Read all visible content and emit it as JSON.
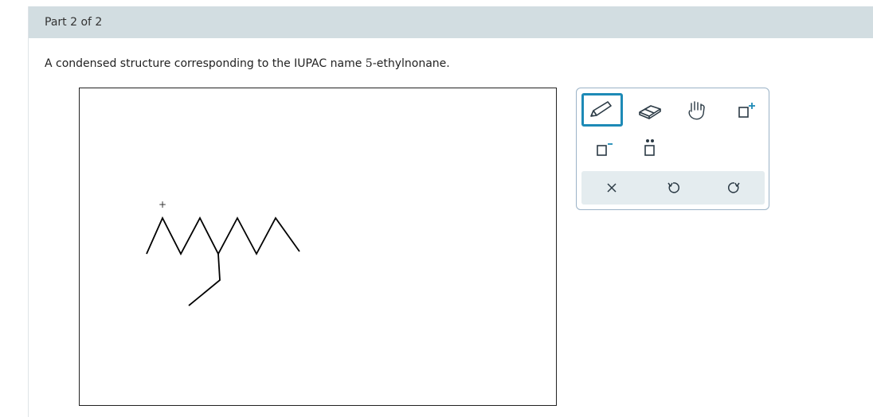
{
  "part_header": {
    "label": "Part 2 of 2"
  },
  "prompt": {
    "text_before": "A condensed structure corresponding to the IUPAC name ",
    "number": "5",
    "text_after": "-ethylnonane."
  },
  "canvas": {
    "cursor_mark": "+"
  },
  "toolbar": {
    "tools": [
      {
        "name": "pencil-icon",
        "selected": true
      },
      {
        "name": "eraser-icon",
        "selected": false
      },
      {
        "name": "hand-icon",
        "selected": false
      },
      {
        "name": "add-positive-charge-icon",
        "selected": false
      },
      {
        "name": "add-negative-charge-icon",
        "selected": false
      },
      {
        "name": "lone-pair-icon",
        "selected": false
      }
    ],
    "actions": [
      {
        "name": "clear-icon"
      },
      {
        "name": "undo-icon"
      },
      {
        "name": "redo-icon"
      }
    ]
  },
  "colors": {
    "header_bg": "#d2dde1",
    "accent": "#1d8ab6",
    "toolbar_border": "#9bb3c7",
    "action_bar_bg": "#e4ecef",
    "icon_stroke": "#2b3a45",
    "charge_color": "#1d8ab6"
  }
}
